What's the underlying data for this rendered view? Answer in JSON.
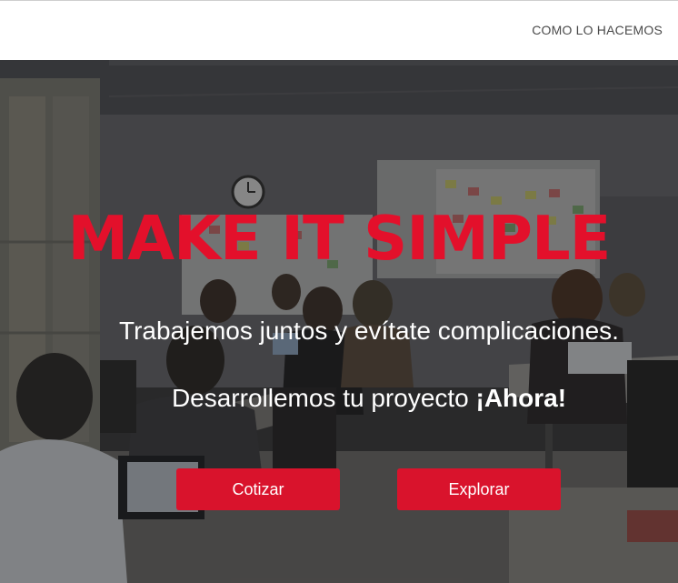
{
  "nav": {
    "link_label": "COMO LO HACEMOS"
  },
  "hero": {
    "headline": "MAKE IT SIMPLE",
    "tagline": "Trabajemos juntos y evítate complicaciones.",
    "cta_prefix": "Desarrollemos tu proyecto ",
    "cta_emphasis": "¡Ahora!",
    "buttons": {
      "quote_label": "Cotizar",
      "explore_label": "Explorar"
    }
  },
  "colors": {
    "accent": "#e3102b",
    "button": "#d9132c",
    "nav_text": "#4a4a4a"
  }
}
